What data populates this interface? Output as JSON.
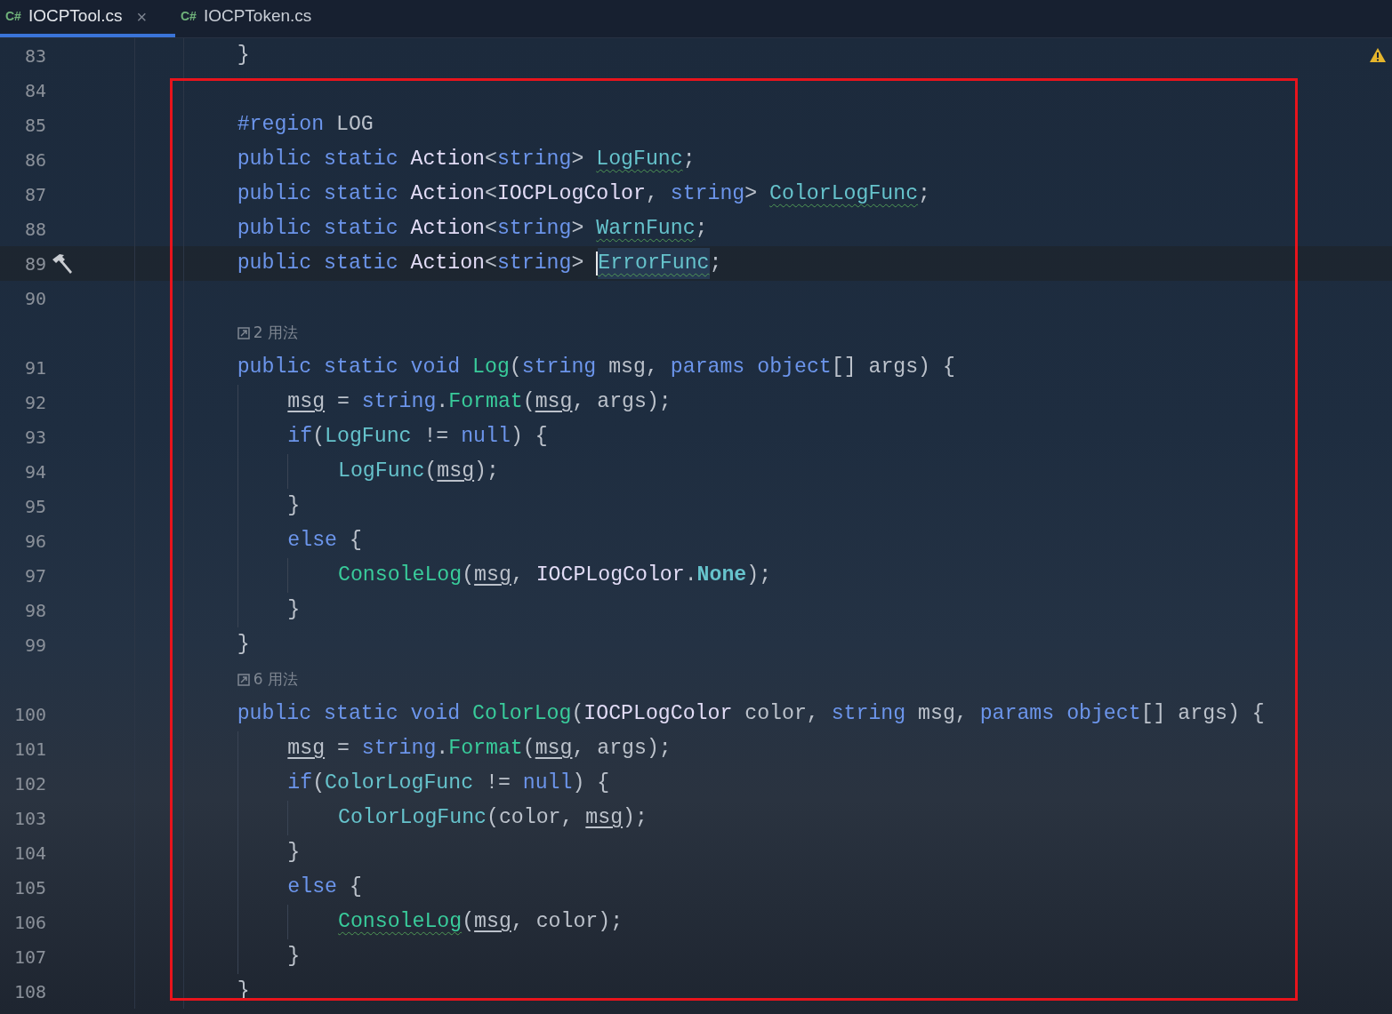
{
  "tabs": [
    {
      "lang": "C#",
      "label": "IOCPTool.cs",
      "selected": true,
      "close": "×"
    },
    {
      "lang": "C#",
      "label": "IOCPToken.cs",
      "selected": false
    }
  ],
  "annotation": {
    "kind": "rectangle",
    "color": "#e8141c"
  },
  "lines": [
    {
      "kind": "code",
      "number": "83",
      "segments": [
        {
          "text": "    }",
          "kind": "plain"
        }
      ]
    },
    {
      "kind": "code",
      "number": "84"
    },
    {
      "kind": "code",
      "number": "85",
      "segments": [
        {
          "text": "    #region",
          "kind": "kw"
        },
        {
          "text": " LOG",
          "kind": "plain"
        }
      ]
    },
    {
      "kind": "code",
      "number": "86",
      "segments": [
        {
          "text": "    public",
          "kind": "kw"
        },
        {
          "text": " static",
          "kind": "kw"
        },
        {
          "text": " Action",
          "kind": "cls"
        },
        {
          "text": "<",
          "kind": "plain"
        },
        {
          "text": "string",
          "kind": "kw"
        },
        {
          "text": ">",
          "kind": "plain"
        },
        {
          "text": " LogFunc",
          "kind": "field_warn"
        },
        {
          "text": ";",
          "kind": "plain"
        }
      ]
    },
    {
      "kind": "code",
      "number": "87",
      "segments": [
        {
          "text": "    public",
          "kind": "kw"
        },
        {
          "text": " static",
          "kind": "kw"
        },
        {
          "text": " Action",
          "kind": "cls"
        },
        {
          "text": "<",
          "kind": "plain"
        },
        {
          "text": "IOCPLogColor",
          "kind": "cls"
        },
        {
          "text": ",",
          "kind": "plain"
        },
        {
          "text": " string",
          "kind": "kw"
        },
        {
          "text": ">",
          "kind": "plain"
        },
        {
          "text": " ColorLogFunc",
          "kind": "field_warn"
        },
        {
          "text": ";",
          "kind": "plain"
        }
      ]
    },
    {
      "kind": "code",
      "number": "88",
      "segments": [
        {
          "text": "    public",
          "kind": "kw"
        },
        {
          "text": " static",
          "kind": "kw"
        },
        {
          "text": " Action",
          "kind": "cls"
        },
        {
          "text": "<",
          "kind": "plain"
        },
        {
          "text": "string",
          "kind": "kw"
        },
        {
          "text": ">",
          "kind": "plain"
        },
        {
          "text": " WarnFunc",
          "kind": "field_warn"
        },
        {
          "text": ";",
          "kind": "plain"
        }
      ]
    },
    {
      "kind": "code",
      "number": "89",
      "current": true,
      "segments": [
        {
          "text": "    public",
          "kind": "kw"
        },
        {
          "text": " static",
          "kind": "kw"
        },
        {
          "text": " Action",
          "kind": "cls"
        },
        {
          "text": "<",
          "kind": "plain"
        },
        {
          "text": "string",
          "kind": "kw"
        },
        {
          "text": ">",
          "kind": "plain"
        },
        {
          "text": " ErrorFunc",
          "kind": "field_warn",
          "caret": true,
          "highlighted": true
        },
        {
          "text": ";",
          "kind": "plain"
        }
      ]
    },
    {
      "kind": "code",
      "number": "90"
    },
    {
      "kind": "hint",
      "text": "2 用法"
    },
    {
      "kind": "code",
      "number": "91",
      "segments": [
        {
          "text": "    public",
          "kind": "kw"
        },
        {
          "text": " static",
          "kind": "kw"
        },
        {
          "text": " void",
          "kind": "kw"
        },
        {
          "text": " Log",
          "kind": "method"
        },
        {
          "text": "(",
          "kind": "plain"
        },
        {
          "text": "string",
          "kind": "kw"
        },
        {
          "text": " msg,",
          "kind": "plain"
        },
        {
          "text": " params",
          "kind": "kw"
        },
        {
          "text": " object",
          "kind": "kw"
        },
        {
          "text": "[] args) {",
          "kind": "plain"
        }
      ]
    },
    {
      "kind": "code",
      "number": "92",
      "segments": [
        {
          "text": "        msg",
          "kind": "local"
        },
        {
          "text": " =",
          "kind": "plain"
        },
        {
          "text": " string",
          "kind": "kw"
        },
        {
          "text": ".",
          "kind": "plain"
        },
        {
          "text": "Format",
          "kind": "method"
        },
        {
          "text": "(",
          "kind": "plain"
        },
        {
          "text": "msg",
          "kind": "local"
        },
        {
          "text": ", args);",
          "kind": "plain"
        }
      ]
    },
    {
      "kind": "code",
      "number": "93",
      "segments": [
        {
          "text": "        if",
          "kind": "kw"
        },
        {
          "text": "(",
          "kind": "plain"
        },
        {
          "text": "LogFunc",
          "kind": "field"
        },
        {
          "text": " !=",
          "kind": "plain"
        },
        {
          "text": " null",
          "kind": "kw"
        },
        {
          "text": ") {",
          "kind": "plain"
        }
      ]
    },
    {
      "kind": "code",
      "number": "94",
      "segments": [
        {
          "text": "            LogFunc",
          "kind": "field"
        },
        {
          "text": "(",
          "kind": "plain"
        },
        {
          "text": "msg",
          "kind": "local"
        },
        {
          "text": ");",
          "kind": "plain"
        }
      ]
    },
    {
      "kind": "code",
      "number": "95",
      "segments": [
        {
          "text": "        }",
          "kind": "plain"
        }
      ]
    },
    {
      "kind": "code",
      "number": "96",
      "segments": [
        {
          "text": "        else",
          "kind": "kw"
        },
        {
          "text": " {",
          "kind": "plain"
        }
      ]
    },
    {
      "kind": "code",
      "number": "97",
      "segments": [
        {
          "text": "            ConsoleLog",
          "kind": "method"
        },
        {
          "text": "(",
          "kind": "plain"
        },
        {
          "text": "msg",
          "kind": "local"
        },
        {
          "text": ",",
          "kind": "plain"
        },
        {
          "text": " IOCPLogColor",
          "kind": "cls"
        },
        {
          "text": ".",
          "kind": "plain"
        },
        {
          "text": "None",
          "kind": "enum"
        },
        {
          "text": ");",
          "kind": "plain"
        }
      ]
    },
    {
      "kind": "code",
      "number": "98",
      "segments": [
        {
          "text": "        }",
          "kind": "plain"
        }
      ]
    },
    {
      "kind": "code",
      "number": "99",
      "segments": [
        {
          "text": "    }",
          "kind": "plain"
        }
      ]
    },
    {
      "kind": "hint",
      "text": "6 用法"
    },
    {
      "kind": "code",
      "number": "100",
      "segments": [
        {
          "text": "    public",
          "kind": "kw"
        },
        {
          "text": " static",
          "kind": "kw"
        },
        {
          "text": " void",
          "kind": "kw"
        },
        {
          "text": " ColorLog",
          "kind": "method"
        },
        {
          "text": "(",
          "kind": "plain"
        },
        {
          "text": "IOCPLogColor",
          "kind": "cls"
        },
        {
          "text": " color,",
          "kind": "plain"
        },
        {
          "text": " string",
          "kind": "kw"
        },
        {
          "text": " msg,",
          "kind": "plain"
        },
        {
          "text": " params",
          "kind": "kw"
        },
        {
          "text": " object",
          "kind": "kw"
        },
        {
          "text": "[] args) {",
          "kind": "plain"
        }
      ]
    },
    {
      "kind": "code",
      "number": "101",
      "segments": [
        {
          "text": "        msg",
          "kind": "local"
        },
        {
          "text": " =",
          "kind": "plain"
        },
        {
          "text": " string",
          "kind": "kw"
        },
        {
          "text": ".",
          "kind": "plain"
        },
        {
          "text": "Format",
          "kind": "method"
        },
        {
          "text": "(",
          "kind": "plain"
        },
        {
          "text": "msg",
          "kind": "local"
        },
        {
          "text": ", args);",
          "kind": "plain"
        }
      ]
    },
    {
      "kind": "code",
      "number": "102",
      "segments": [
        {
          "text": "        if",
          "kind": "kw"
        },
        {
          "text": "(",
          "kind": "plain"
        },
        {
          "text": "ColorLogFunc",
          "kind": "field"
        },
        {
          "text": " !=",
          "kind": "plain"
        },
        {
          "text": " null",
          "kind": "kw"
        },
        {
          "text": ") {",
          "kind": "plain"
        }
      ]
    },
    {
      "kind": "code",
      "number": "103",
      "segments": [
        {
          "text": "            ColorLogFunc",
          "kind": "field"
        },
        {
          "text": "(color,",
          "kind": "plain"
        },
        {
          "text": " msg",
          "kind": "local"
        },
        {
          "text": ");",
          "kind": "plain"
        }
      ]
    },
    {
      "kind": "code",
      "number": "104",
      "segments": [
        {
          "text": "        }",
          "kind": "plain"
        }
      ]
    },
    {
      "kind": "code",
      "number": "105",
      "segments": [
        {
          "text": "        else",
          "kind": "kw"
        },
        {
          "text": " {",
          "kind": "plain"
        }
      ]
    },
    {
      "kind": "code",
      "number": "106",
      "segments": [
        {
          "text": "            ConsoleLog",
          "kind": "method_warn"
        },
        {
          "text": "(",
          "kind": "plain"
        },
        {
          "text": "msg",
          "kind": "local"
        },
        {
          "text": ",",
          "kind": "plain"
        },
        {
          "text": " color);",
          "kind": "plain"
        }
      ]
    },
    {
      "kind": "code",
      "number": "107",
      "segments": [
        {
          "text": "        }",
          "kind": "plain"
        }
      ]
    },
    {
      "kind": "code",
      "number": "108",
      "segments": [
        {
          "text": "    }",
          "kind": "plain"
        }
      ]
    }
  ]
}
